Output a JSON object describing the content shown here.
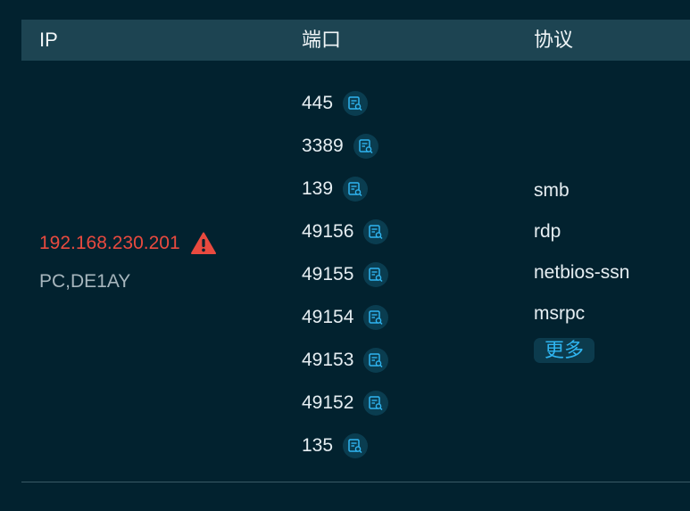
{
  "headers": {
    "ip": "IP",
    "port": "端口",
    "protocol": "协议"
  },
  "row": {
    "ip": "192.168.230.201",
    "host": "PC,DE1AY",
    "ports": [
      "445",
      "3389",
      "139",
      "49156",
      "49155",
      "49154",
      "49153",
      "49152",
      "135"
    ],
    "protocols": [
      "smb",
      "rdp",
      "netbios-ssn",
      "msrpc"
    ],
    "more_label": "更多"
  },
  "colors": {
    "background": "#02222f",
    "header": "#1d4452",
    "alert": "#e94a3f",
    "accent": "#2fb4f0"
  },
  "icons": {
    "alert": "warning-triangle-icon",
    "port_detail": "port-detail-search-icon"
  }
}
